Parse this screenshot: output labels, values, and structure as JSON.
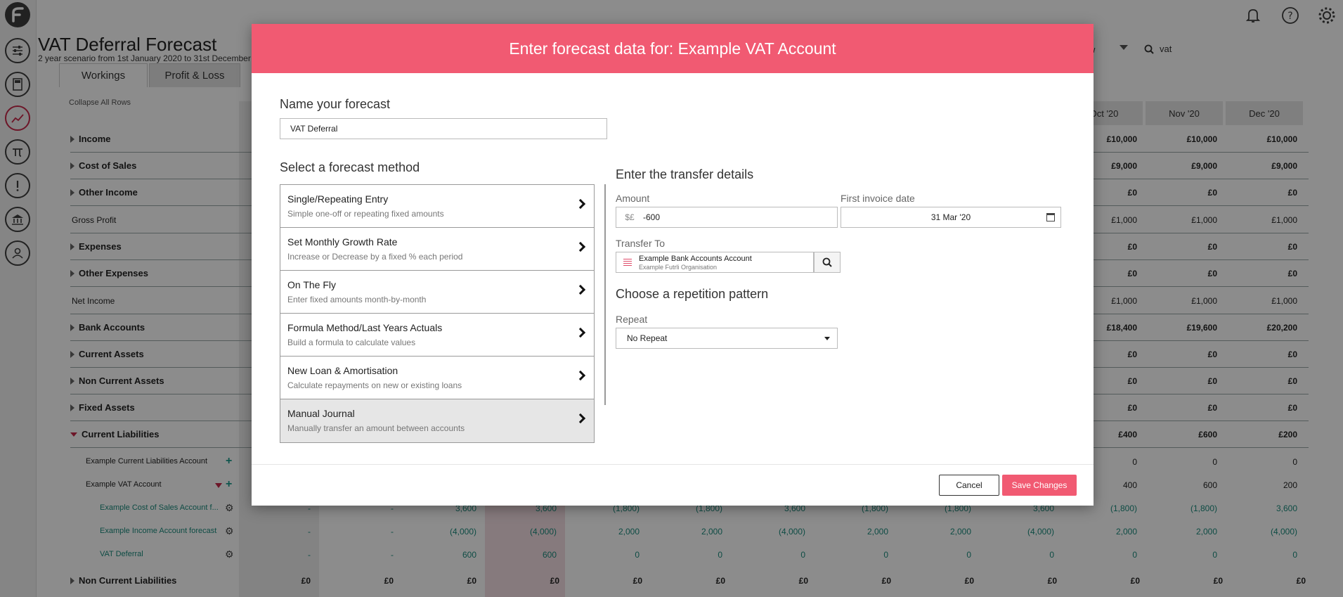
{
  "app": {
    "page_title": "VAT Deferral Forecast",
    "page_subtitle": "2 year scenario from 1st January 2020 to 31st December",
    "search_value": "vat",
    "view_fragment": "w",
    "accent": "#c6294a",
    "modal_accent": "#f15a72",
    "teal": "#1a8a7d"
  },
  "tabs": [
    {
      "label": "Workings"
    },
    {
      "label": "Profit & Loss"
    }
  ],
  "grid": {
    "collapse_label": "Collapse All Rows",
    "months": [
      "Oct '20",
      "Nov '20",
      "Dec '20"
    ],
    "rows": [
      {
        "label": "Income",
        "values": [
          "£10,000",
          "£10,000",
          "£10,000"
        ]
      },
      {
        "label": "Cost of Sales",
        "values": [
          "£9,000",
          "£9,000",
          "£9,000"
        ]
      },
      {
        "label": "Other Income",
        "values": [
          "£0",
          "£0",
          "£0"
        ]
      },
      {
        "label": "Gross Profit",
        "values": [
          "£1,000",
          "£1,000",
          "£1,000"
        ]
      },
      {
        "label": "Expenses",
        "values": [
          "£0",
          "£0",
          "£0"
        ]
      },
      {
        "label": "Other Expenses",
        "values": [
          "£0",
          "£0",
          "£0"
        ]
      },
      {
        "label": "Net Income",
        "values": [
          "£1,000",
          "£1,000",
          "£1,000"
        ]
      },
      {
        "label": "Bank Accounts",
        "values": [
          "£18,400",
          "£19,600",
          "£20,200"
        ]
      },
      {
        "label": "Current Assets",
        "values": [
          "£0",
          "£0",
          "£0"
        ]
      },
      {
        "label": "Non Current Assets",
        "values": [
          "£0",
          "£0",
          "£0"
        ]
      },
      {
        "label": "Fixed Assets",
        "values": [
          "£0",
          "£0",
          "£0"
        ]
      },
      {
        "label": "Current Liabilities",
        "values": [
          "£400",
          "£600",
          "£200"
        ]
      }
    ],
    "sub_rows": [
      {
        "label": "Example Current Liabilities Account",
        "values": [
          "0",
          "0",
          "0"
        ]
      },
      {
        "label": "Example VAT Account",
        "values": [
          "400",
          "600",
          "200"
        ]
      },
      {
        "label": "Example Cost of Sales Account f...",
        "values": [
          "(1,800)",
          "(1,800)",
          "3,600"
        ]
      },
      {
        "label": "Example Income Account forecast",
        "values": [
          "2,000",
          "2,000",
          "(4,000)"
        ]
      },
      {
        "label": "VAT Deferral",
        "values": [
          "0",
          "0",
          "0"
        ]
      }
    ],
    "detail_values": [
      [
        "-",
        "-",
        "3,600",
        "3,600",
        "(1,800)",
        "(1,800)",
        "3,600",
        "(1,800)",
        "(1,800)",
        "3,600"
      ],
      [
        "-",
        "-",
        "(4,000)",
        "(4,000)",
        "2,000",
        "2,000",
        "(4,000)",
        "2,000",
        "2,000",
        "(4,000)"
      ],
      [
        "-",
        "-",
        "600",
        "600",
        "0",
        "0",
        "0",
        "0",
        "0",
        "0"
      ]
    ],
    "last_row": {
      "label": "Non Current Liabilities",
      "values": [
        "£0",
        "£0",
        "£0",
        "£0",
        "£0",
        "£0",
        "£0",
        "£0",
        "£0",
        "£0",
        "£0",
        "£0",
        "£0"
      ]
    }
  },
  "modal": {
    "title": "Enter forecast data for: Example VAT Account",
    "name_label": "Name your forecast",
    "name_value": "VAT Deferral",
    "method_label": "Select a forecast method",
    "methods": [
      {
        "title": "Single/Repeating Entry",
        "subtitle": "Simple one-off or repeating fixed amounts"
      },
      {
        "title": "Set Monthly Growth Rate",
        "subtitle": "Increase or Decrease by a fixed % each period"
      },
      {
        "title": "On The Fly",
        "subtitle": "Enter fixed amounts month-by-month"
      },
      {
        "title": "Formula Method/Last Years Actuals",
        "subtitle": "Build a formula to calculate values"
      },
      {
        "title": "New Loan & Amortisation",
        "subtitle": "Calculate repayments on new or existing loans"
      },
      {
        "title": "Manual Journal",
        "subtitle": "Manually transfer an amount between accounts"
      }
    ],
    "transfer_title": "Enter the transfer details",
    "amount_label": "Amount",
    "amount_currency": "$£",
    "amount_value": "-600",
    "date_label": "First invoice date",
    "date_value": "31 Mar '20",
    "transfer_label": "Transfer To",
    "transfer_account": "Example Bank Accounts Account",
    "transfer_org": "Example Futrli Organisation",
    "repeat_title": "Choose a repetition pattern",
    "repeat_label": "Repeat",
    "repeat_value": "No Repeat",
    "cancel_label": "Cancel",
    "save_label": "Save Changes"
  }
}
